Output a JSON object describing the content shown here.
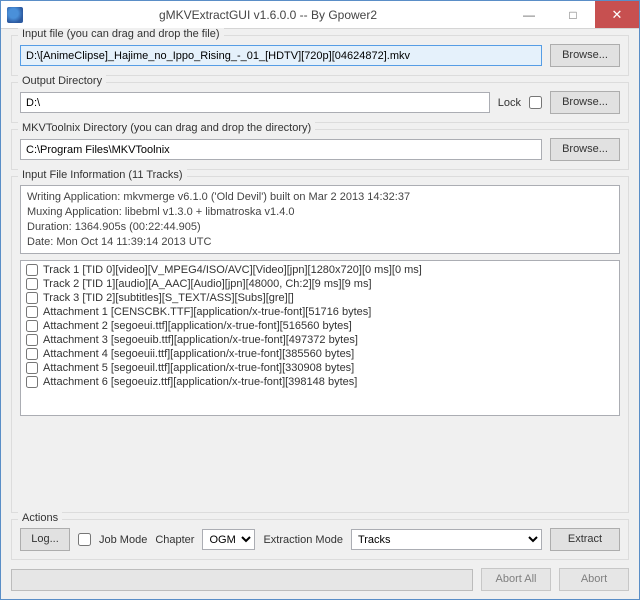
{
  "window": {
    "title": "gMKVExtractGUI v1.6.0.0 -- By Gpower2",
    "min": "—",
    "max": "□",
    "close": "✕"
  },
  "groups": {
    "input_file": "Input file (you can drag and drop the file)",
    "output_dir": "Output Directory",
    "toolnix_dir": "MKVToolnix Directory (you can drag and drop the directory)",
    "file_info": "Input File Information (11 Tracks)",
    "actions": "Actions"
  },
  "fields": {
    "input_file": "D:\\[AnimeClipse]_Hajime_no_Ippo_Rising_-_01_[HDTV][720p][04624872].mkv",
    "output_dir": "D:\\",
    "toolnix_dir": "C:\\Program Files\\MKVToolnix"
  },
  "buttons": {
    "browse": "Browse...",
    "log": "Log...",
    "extract": "Extract",
    "abort_all": "Abort All",
    "abort": "Abort"
  },
  "labels": {
    "lock": "Lock",
    "job_mode": "Job Mode",
    "chapter": "Chapter",
    "extraction_mode": "Extraction Mode"
  },
  "selects": {
    "chapter": "OGM",
    "extraction_mode": "Tracks"
  },
  "info": {
    "l1": "Writing Application: mkvmerge v6.1.0 ('Old Devil') built on Mar  2 2013 14:32:37",
    "l2": "Muxing Application: libebml v1.3.0 + libmatroska v1.4.0",
    "l3": "Duration: 1364.905s (00:22:44.905)",
    "l4": "Date: Mon Oct 14 11:39:14 2013 UTC"
  },
  "tracks": [
    "Track 1 [TID 0][video][V_MPEG4/ISO/AVC][Video][jpn][1280x720][0 ms][0 ms]",
    "Track 2 [TID 1][audio][A_AAC][Audio][jpn][48000, Ch:2][9 ms][9 ms]",
    "Track 3 [TID 2][subtitles][S_TEXT/ASS][Subs][gre][]",
    "Attachment 1 [CENSCBK.TTF][application/x-true-font][51716 bytes]",
    "Attachment 2 [segoeui.ttf][application/x-true-font][516560 bytes]",
    "Attachment 3 [segoeuib.ttf][application/x-true-font][497372 bytes]",
    "Attachment 4 [segoeuii.ttf][application/x-true-font][385560 bytes]",
    "Attachment 5 [segoeuil.ttf][application/x-true-font][330908 bytes]",
    "Attachment 6 [segoeuiz.ttf][application/x-true-font][398148 bytes]"
  ]
}
